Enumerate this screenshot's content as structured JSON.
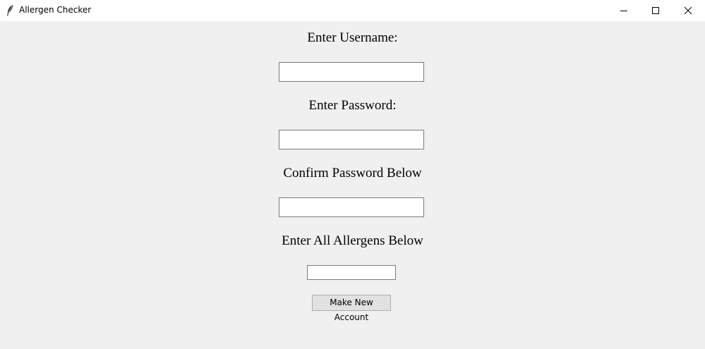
{
  "window": {
    "title": "Allergen Checker",
    "app_icon": "feather-icon",
    "controls": [
      "minimize-icon",
      "maximize-icon",
      "close-icon"
    ]
  },
  "form": {
    "username_label": "Enter Username:",
    "username_value": "",
    "password_label": "Enter Password:",
    "password_value": "",
    "confirm_label": "Confirm Password Below",
    "confirm_value": "",
    "allergens_label": "Enter All Allergens Below",
    "allergens_value": "",
    "submit_label": "Make New Account"
  }
}
